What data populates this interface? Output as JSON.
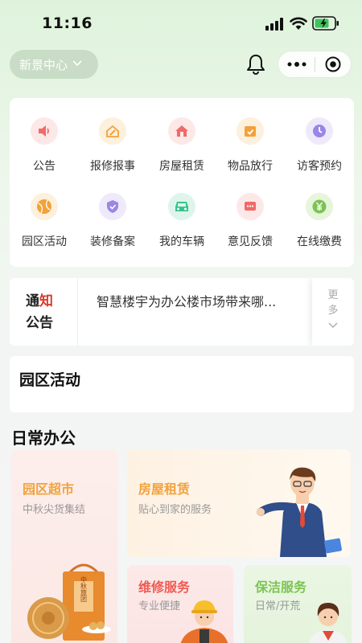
{
  "status_bar": {
    "time": "11:16"
  },
  "header": {
    "location": "新景中心"
  },
  "services": [
    {
      "label": "公告",
      "icon": "speaker-icon",
      "color": "#f06a6a"
    },
    {
      "label": "报修报事",
      "icon": "repair-icon",
      "color": "#f2a23a"
    },
    {
      "label": "房屋租赁",
      "icon": "house-icon",
      "color": "#f06a6a"
    },
    {
      "label": "物品放行",
      "icon": "package-icon",
      "color": "#f2a23a"
    },
    {
      "label": "访客预约",
      "icon": "clock-icon",
      "color": "#9b86e6"
    },
    {
      "label": "园区活动",
      "icon": "ball-icon",
      "color": "#f2a23a"
    },
    {
      "label": "装修备案",
      "icon": "shield-icon",
      "color": "#9b86e6"
    },
    {
      "label": "我的车辆",
      "icon": "car-icon",
      "color": "#36c48e"
    },
    {
      "label": "意见反馈",
      "icon": "feedback-icon",
      "color": "#f06a6a"
    },
    {
      "label": "在线缴费",
      "icon": "yuan-icon",
      "color": "#7cc452"
    }
  ],
  "notice": {
    "title_1a": "通",
    "title_1b": "知",
    "title_2": "公告",
    "text": "智慧楼宇为办公楼市场带来哪...",
    "more_1": "更",
    "more_2": "多"
  },
  "activities": {
    "title": "园区活动"
  },
  "office": {
    "title": "日常办公",
    "tiles": [
      {
        "title": "园区超市",
        "subtitle": "中秋尖货集结"
      },
      {
        "title": "房屋租赁",
        "subtitle": "贴心到家的服务"
      },
      {
        "title": "维修服务",
        "subtitle": "专业便捷"
      },
      {
        "title": "保洁服务",
        "subtitle": "日常/开荒"
      }
    ],
    "mooncake_box_text": "中秋旅团"
  }
}
